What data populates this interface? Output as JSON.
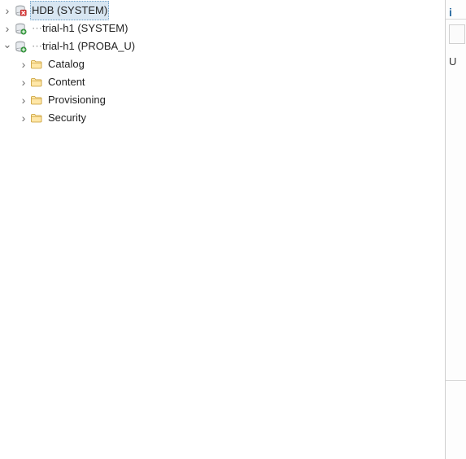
{
  "tree": {
    "nodes": [
      {
        "icon": "db-red-icon",
        "label": "HDB (SYSTEM)",
        "expanded": false,
        "selected": true,
        "children": []
      },
      {
        "icon": "db-green-badge-icon",
        "label_obscured_prefix": "⋯",
        "label": "trial-h1 (SYSTEM)",
        "expanded": false,
        "selected": false,
        "children": []
      },
      {
        "icon": "db-green-badge-icon",
        "label_obscured_prefix": "⋯",
        "label": "trial-h1 (PROBA_U)",
        "expanded": true,
        "selected": false,
        "children": [
          {
            "icon": "folder-icon",
            "label": "Catalog"
          },
          {
            "icon": "folder-icon",
            "label": "Content"
          },
          {
            "icon": "folder-icon",
            "label": "Provisioning"
          },
          {
            "icon": "folder-icon",
            "label": "Security"
          }
        ]
      }
    ]
  },
  "side": {
    "tab_letter": "i",
    "body_letter": "U"
  }
}
